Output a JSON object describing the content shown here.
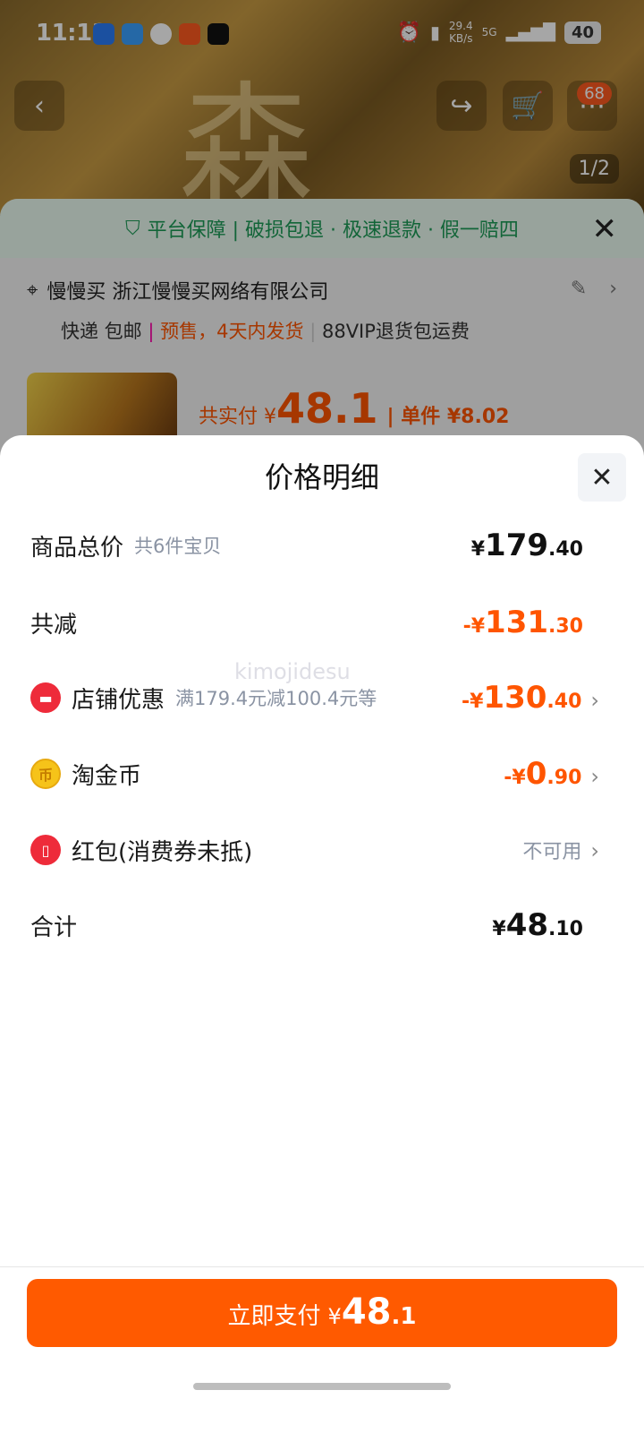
{
  "status_bar": {
    "time": "11:13",
    "net_speed": "29.4",
    "net_unit": "KB/s",
    "network": "5G",
    "battery": "40"
  },
  "product_page": {
    "badge_count": "68",
    "pager": "1/2",
    "guarantee_text": "平台保障 | 破损包退 · 极速退款 · 假一赔四",
    "address_name": "慢慢买 浙江慢慢买网络有限公司",
    "shipping": "快递 包邮",
    "presale": "预售，4天内发货",
    "vip_note": "88VIP退货包运费",
    "total_paid_label": "共实付 ¥",
    "total_paid_value": "48.1",
    "unit_price": "| 单件 ¥8.02",
    "hero_glyph": "森"
  },
  "price_detail": {
    "title": "价格明细",
    "watermark": "kimojidesu",
    "rows": [
      {
        "label": "商品总价",
        "sub": "共6件宝贝",
        "cur": "¥",
        "int": "179",
        "dec": ".40"
      },
      {
        "label": "共减",
        "cur": "-¥",
        "int": "131",
        "dec": ".30"
      },
      {
        "label": "店铺优惠",
        "sub": "满179.4元减100.4元等",
        "cur": "-¥",
        "int": "130",
        "dec": ".40"
      },
      {
        "label": "淘金币",
        "cur": "-¥",
        "int": "0",
        "dec": ".90"
      },
      {
        "label": "红包(消费券未抵)",
        "status": "不可用"
      },
      {
        "label": "合计",
        "cur": "¥",
        "int": "48",
        "dec": ".10"
      }
    ],
    "pay_button": {
      "label": "立即支付",
      "cur": "¥",
      "int": "48",
      "dec": ".1"
    }
  },
  "colors": {
    "accent": "#ff5500",
    "button": "#ff5a00",
    "guarantee_green": "#1c9b57"
  }
}
